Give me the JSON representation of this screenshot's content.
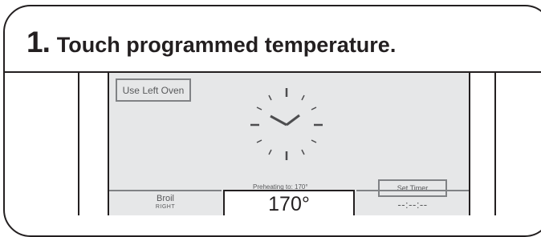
{
  "step": {
    "number": "1.",
    "text": "Touch programmed temperature."
  },
  "screen": {
    "left_oven_button": "Use Left Oven",
    "clock_icon": "analog-clock-icon",
    "preheat_status": "Preheating to: 170°",
    "set_timer_button": "Set Timer",
    "mode": {
      "label": "Broil",
      "sub": "RIGHT"
    },
    "temperature": "170°",
    "time_display": "--:--:--"
  },
  "colors": {
    "screen_bg": "#e6e7e8",
    "outline": "#231f20",
    "button_border": "#808285",
    "text_gray": "#58595b"
  }
}
